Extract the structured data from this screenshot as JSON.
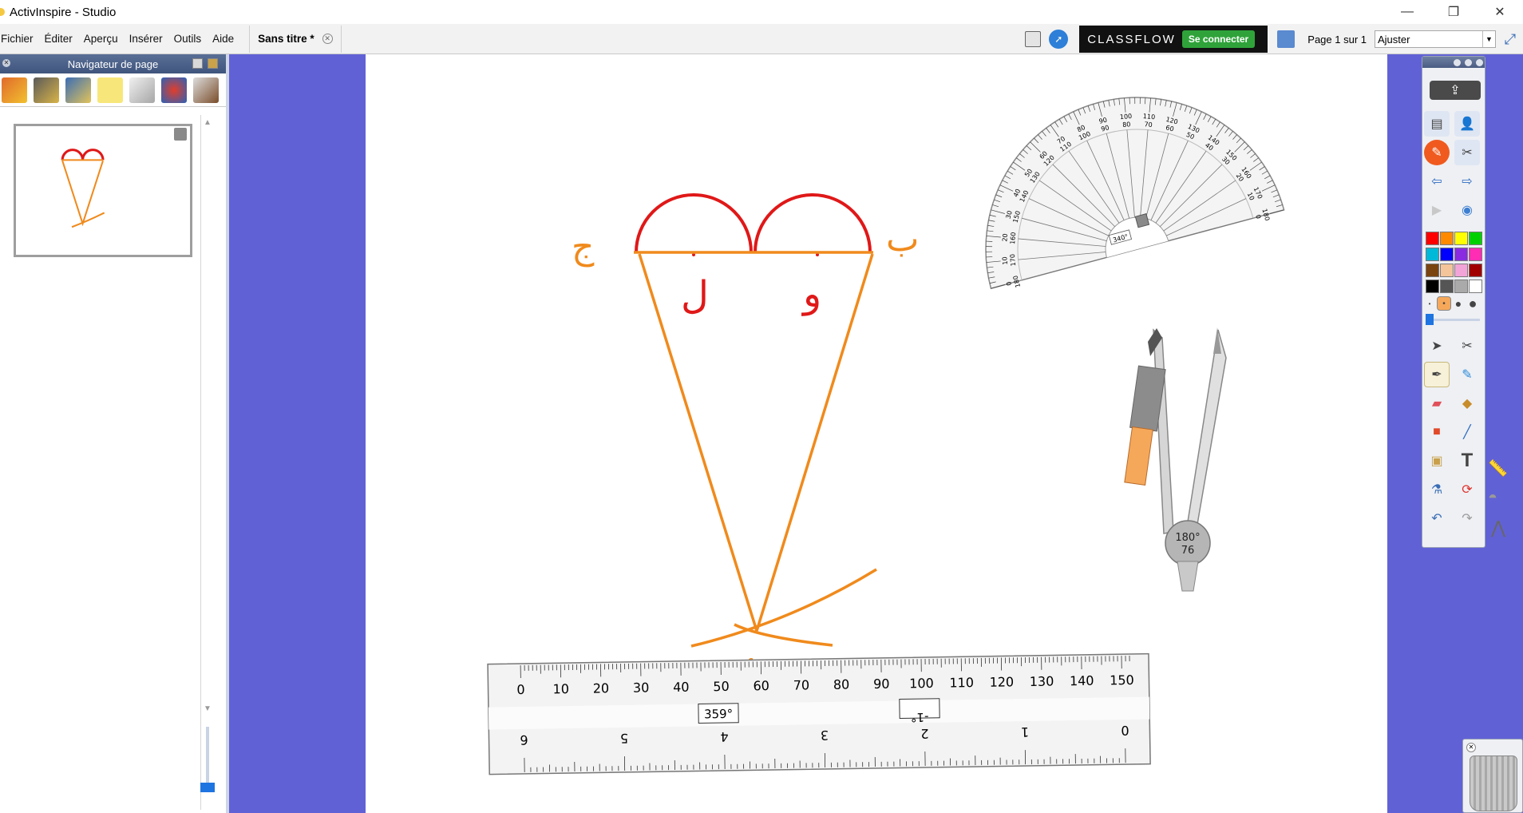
{
  "window": {
    "title": "ActivInspire - Studio",
    "minimize": "—",
    "maximize": "❐",
    "close": "✕"
  },
  "menu": {
    "items": [
      "Fichier",
      "Éditer",
      "Aperçu",
      "Insérer",
      "Outils",
      "Aide"
    ],
    "doc_tab": "Sans titre *"
  },
  "toolbar_right": {
    "classflow_logo": "CLASSFLOW",
    "classflow_button": "Se connecter",
    "page_label": "Page 1 sur 1",
    "zoom_value": "Ajuster"
  },
  "navigator": {
    "title": "Navigateur de page"
  },
  "canvas": {
    "letters": {
      "top_left": "ج",
      "top_right": "ب",
      "inner_left": "ل",
      "inner_right": "و",
      "bottom": "أ"
    },
    "protractor": {
      "readout": "340°",
      "ticks_outer": [
        "0",
        "10",
        "20",
        "30",
        "40",
        "50",
        "60",
        "70",
        "80",
        "90",
        "100",
        "110",
        "120",
        "130",
        "140",
        "150",
        "160",
        "170",
        "180"
      ],
      "ticks_inner": [
        "180",
        "170",
        "160",
        "150",
        "140",
        "130",
        "120",
        "110",
        "100",
        "90",
        "80",
        "70",
        "60",
        "50",
        "40",
        "30",
        "20",
        "10",
        "0"
      ]
    },
    "compass": {
      "angle": "180°",
      "value": "76"
    },
    "ruler": {
      "cm_labels": [
        "0",
        "10",
        "20",
        "30",
        "40",
        "50",
        "60",
        "70",
        "80",
        "90",
        "100",
        "110",
        "120",
        "130",
        "140",
        "150"
      ],
      "inch_labels": [
        "6",
        "5",
        "4",
        "3",
        "2",
        "1",
        "0"
      ],
      "angle_readout": "359°",
      "angle_readout_2": "-1°"
    }
  },
  "colors": {
    "workspace": "#6161d6",
    "red_stroke": "#e01818",
    "orange_stroke": "#f08a1c"
  },
  "icons": {
    "navigator_tools": [
      "pages-icon",
      "resources-icon",
      "objects-icon",
      "notes-icon",
      "properties-icon",
      "actions-icon",
      "voting-icon"
    ]
  }
}
